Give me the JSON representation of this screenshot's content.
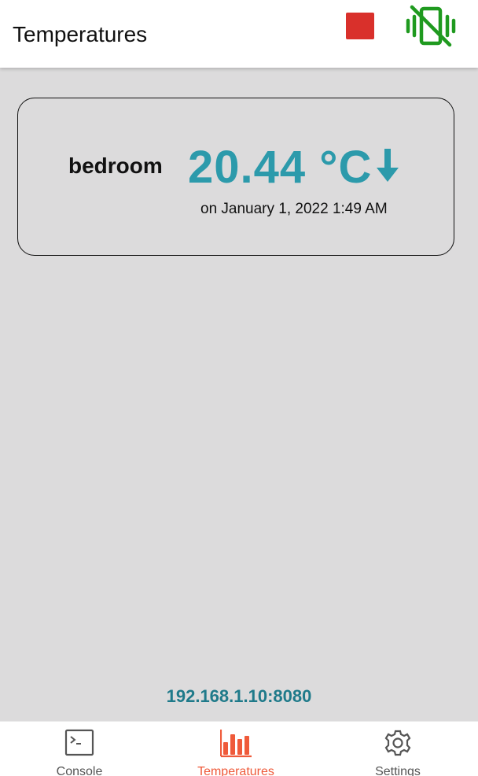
{
  "appbar": {
    "title": "Temperatures",
    "stop_icon": "stop-square-icon",
    "stop_color": "#d9302b",
    "vibrate_icon": "vibrate-off-icon",
    "vibrate_color": "#1f9a1f"
  },
  "sensors": [
    {
      "name": "bedroom",
      "temperature": "20.44 °C",
      "trend": "down",
      "trend_icon": "arrow-down-icon",
      "updated": "on January 1, 2022 1:49 AM",
      "color": "#2c9aab"
    }
  ],
  "server": {
    "address": "192.168.1.10:8080"
  },
  "bottom_nav": {
    "items": [
      {
        "label": "Console",
        "icon": "terminal-icon",
        "active": false
      },
      {
        "label": "Temperatures",
        "icon": "bar-chart-icon",
        "active": true
      },
      {
        "label": "Settings",
        "icon": "gear-icon",
        "active": false
      }
    ],
    "active_color": "#ef5a3a",
    "inactive_color": "#555555"
  }
}
